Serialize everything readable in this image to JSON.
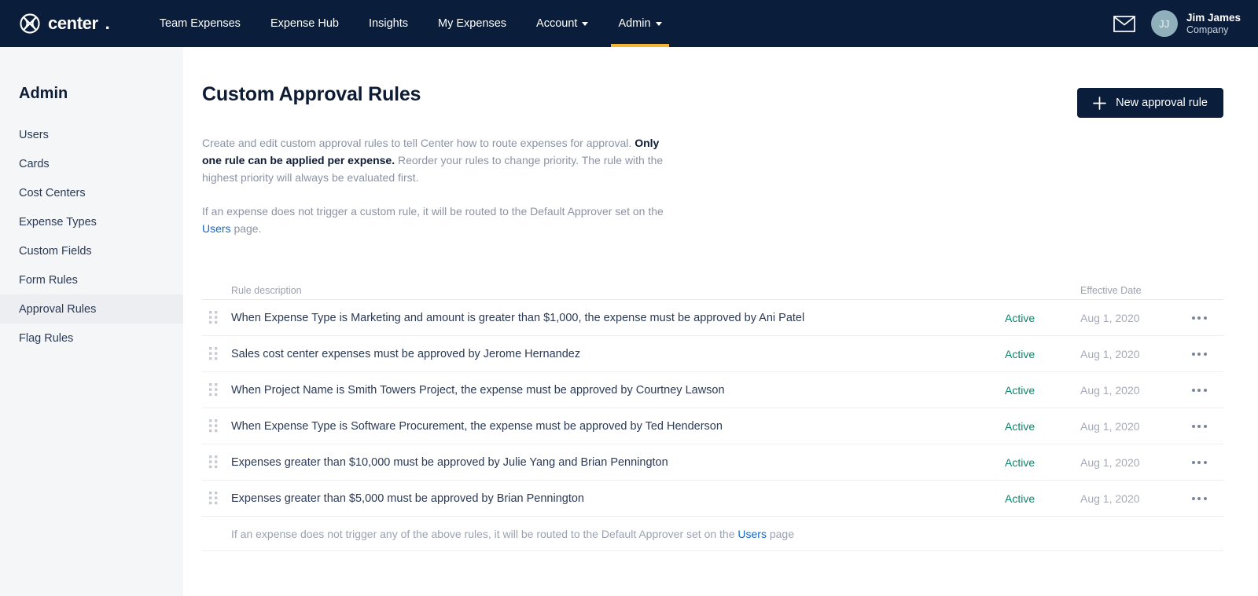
{
  "topnav": {
    "logo_text": "center",
    "logo_icon": "center-circle-logo-icon",
    "items": [
      {
        "label": "Team Expenses",
        "has_caret": false,
        "active": false
      },
      {
        "label": "Expense Hub",
        "has_caret": false,
        "active": false
      },
      {
        "label": "Insights",
        "has_caret": false,
        "active": false
      },
      {
        "label": "My Expenses",
        "has_caret": false,
        "active": false
      },
      {
        "label": "Account",
        "has_caret": true,
        "active": false
      },
      {
        "label": "Admin",
        "has_caret": true,
        "active": true
      }
    ],
    "mail_icon": "envelope-icon",
    "user": {
      "initials": "JJ",
      "name": "Jim James",
      "org": "Company"
    },
    "colors": {
      "background": "#0a1d3a",
      "active_underline": "#f5b335",
      "avatar": "#8fb0bb"
    }
  },
  "sidebar": {
    "title": "Admin",
    "items": [
      {
        "label": "Users",
        "active": false
      },
      {
        "label": "Cards",
        "active": false
      },
      {
        "label": "Cost Centers",
        "active": false
      },
      {
        "label": "Expense Types",
        "active": false
      },
      {
        "label": "Custom Fields",
        "active": false
      },
      {
        "label": "Form Rules",
        "active": false
      },
      {
        "label": "Approval Rules",
        "active": true
      },
      {
        "label": "Flag Rules",
        "active": false
      }
    ]
  },
  "main": {
    "page_title": "Custom Approval Rules",
    "new_rule_button": "New approval rule",
    "intro": {
      "p1_part1": "Create and edit custom approval rules to tell Center how to route expenses for approval. ",
      "p1_bold": "Only one rule can be applied per expense.",
      "p1_part2": " Reorder your rules to change priority. The rule with the highest priority will always be evaluated first.",
      "p2_part1": "If an expense does not trigger a custom rule, it will be routed to the Default Approver set on the ",
      "p2_link": "Users",
      "p2_part2": " page."
    },
    "table": {
      "headers": {
        "description": "Rule description",
        "effective_date": "Effective Date"
      },
      "rows": [
        {
          "description": "When Expense Type is Marketing and amount is greater than $1,000, the expense must be approved by Ani Patel",
          "status": "Active",
          "effective_date": "Aug 1, 2020"
        },
        {
          "description": "Sales cost center expenses must be approved by Jerome Hernandez",
          "status": "Active",
          "effective_date": "Aug 1, 2020"
        },
        {
          "description": "When Project Name is Smith Towers Project, the expense must be approved by Courtney Lawson",
          "status": "Active",
          "effective_date": "Aug 1, 2020"
        },
        {
          "description": "When Expense Type is Software Procurement, the expense must be approved by Ted Henderson",
          "status": "Active",
          "effective_date": "Aug 1, 2020"
        },
        {
          "description": "Expenses greater than $10,000 must be approved by Julie Yang and Brian Pennington",
          "status": "Active",
          "effective_date": "Aug 1, 2020"
        },
        {
          "description": "Expenses greater than $5,000 must be approved by Brian Pennington",
          "status": "Active",
          "effective_date": "Aug 1, 2020"
        }
      ],
      "footer": {
        "part1": "If an expense does not trigger any of the above rules, it will be routed to the Default Approver set on the ",
        "link": "Users",
        "part2": " page"
      }
    },
    "colors": {
      "status_active": "#08876b",
      "link": "#1267c8",
      "button": "#0a1d3a"
    }
  }
}
